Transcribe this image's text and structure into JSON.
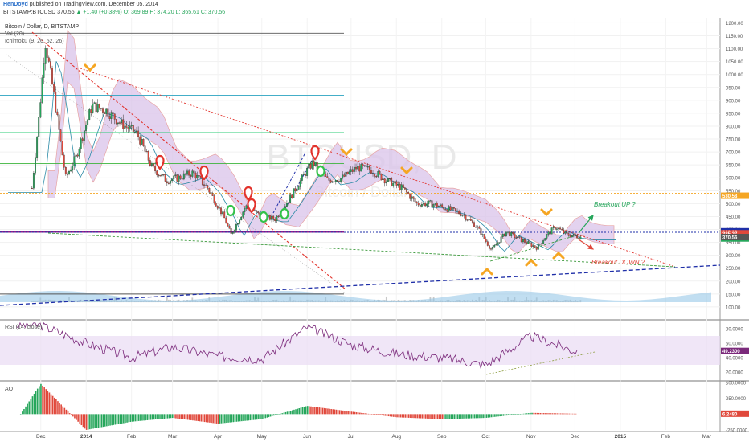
{
  "header": {
    "author": "HenDoyd",
    "published_text": "published on TradingView.com, December 05, 2014",
    "symbol": "BITSTAMP:BTCUSD",
    "last": "370.56",
    "change": "▲ +1.40 (+0.38%)",
    "open": "O: 369.89",
    "high": "H: 374.20",
    "low": "L: 365.61",
    "close": "C: 370.56"
  },
  "panes": {
    "main_title": "Bitcoin / Dollar, D, BITSTAMP",
    "vol_label": "Vol (20)",
    "ichimoku_label": "Ichimoku (9, 26, 52, 26)",
    "watermark": "BTCUSD, D",
    "watermark_sub": "Bitcoin / Dollar",
    "rsi_label": "RSI (14, close)",
    "ao_label": "AO"
  },
  "annotations": {
    "breakout_up": "Breakout UP ?",
    "breakout_down": "Breakout DOWN ?"
  },
  "colors": {
    "up": "#26a65b",
    "down": "#e0483b",
    "trend_red": "#e2322b",
    "trend_blue": "#1f2fa8",
    "purple_line": "#8b1e8b",
    "orange_line": "#f5a623",
    "rsi_line": "#7b2a7b",
    "cloud_fill": "#d9c3ea",
    "volume": "#8ec3e6"
  },
  "chart_data": [
    {
      "type": "line",
      "title": "Bitcoin / Dollar, D, BITSTAMP",
      "x": [
        "2013-11-25",
        "2013-11-30",
        "2013-12-04",
        "2013-12-10",
        "2013-12-18",
        "2013-12-25",
        "2014-01-05",
        "2014-01-15",
        "2014-01-25",
        "2014-02-05",
        "2014-02-15",
        "2014-02-25",
        "2014-03-05",
        "2014-03-15",
        "2014-03-25",
        "2014-04-05",
        "2014-04-10",
        "2014-04-20",
        "2014-05-01",
        "2014-05-10",
        "2014-05-20",
        "2014-06-01",
        "2014-06-05",
        "2014-06-15",
        "2014-06-25",
        "2014-07-05",
        "2014-07-15",
        "2014-07-25",
        "2014-08-05",
        "2014-08-15",
        "2014-08-25",
        "2014-09-05",
        "2014-09-15",
        "2014-09-25",
        "2014-10-05",
        "2014-10-15",
        "2014-10-25",
        "2014-11-05",
        "2014-11-12",
        "2014-11-18",
        "2014-11-25",
        "2014-12-05"
      ],
      "y": [
        560,
        850,
        1130,
        920,
        600,
        680,
        880,
        860,
        810,
        770,
        640,
        590,
        600,
        620,
        560,
        450,
        380,
        490,
        450,
        440,
        520,
        630,
        660,
        590,
        600,
        640,
        630,
        590,
        560,
        500,
        500,
        480,
        460,
        410,
        320,
        390,
        360,
        330,
        380,
        410,
        380,
        370.56
      ],
      "ylim": [
        50,
        1220
      ],
      "y_ticks": [
        100,
        150,
        200,
        250,
        300,
        350,
        400,
        450,
        500,
        550,
        600,
        650,
        700,
        750,
        800,
        850,
        900,
        950,
        1000,
        1050,
        1100,
        1150,
        1200
      ],
      "x_tick_labels": [
        "Dec",
        "2014",
        "Feb",
        "Mar",
        "Apr",
        "May",
        "Jun",
        "Jul",
        "Aug",
        "Sep",
        "Oct",
        "Nov",
        "Dec",
        "2015",
        "Feb",
        "Mar"
      ],
      "price_labels": [
        {
          "value": 530.58,
          "text": "530.58",
          "color": "#f5a623"
        },
        {
          "value": 392.88,
          "text": "392.88",
          "color": "#1f2fa8"
        },
        {
          "value": 385.27,
          "text": "385.27",
          "color": "#e0483b"
        },
        {
          "value": 365.14,
          "text": "365.14",
          "color": "#26a65b"
        },
        {
          "value": 370.56,
          "text": "370.56",
          "color": "#555555"
        }
      ],
      "horizontal_levels": [
        {
          "value": 1160,
          "color": "#555555"
        },
        {
          "value": 920,
          "color": "#2aa3c0"
        },
        {
          "value": 775,
          "color": "#2ccc77"
        },
        {
          "value": 655,
          "color": "#3cb43c"
        },
        {
          "value": 540,
          "color": "#f5a623"
        },
        {
          "value": 390,
          "color": "#8b1e8b"
        },
        {
          "value": 150,
          "color": "#555555"
        }
      ],
      "xlabel": "",
      "ylabel": ""
    },
    {
      "type": "line",
      "title": "RSI (14, close)",
      "x": [
        "2013-12",
        "2014-01",
        "2014-02",
        "2014-03",
        "2014-04",
        "2014-05",
        "2014-06",
        "2014-07",
        "2014-08",
        "2014-09",
        "2014-10",
        "2014-11",
        "2014-12"
      ],
      "y": [
        85,
        60,
        40,
        55,
        42,
        38,
        82,
        58,
        45,
        40,
        30,
        70,
        49.23
      ],
      "ylim": [
        10,
        90
      ],
      "y_ticks": [
        20,
        40,
        60,
        80
      ],
      "last_value": "49.2300",
      "xlabel": "",
      "ylabel": ""
    },
    {
      "type": "bar",
      "title": "AO",
      "x": [
        "2013-12",
        "2014-01",
        "2014-02",
        "2014-03",
        "2014-04",
        "2014-05",
        "2014-06",
        "2014-07",
        "2014-08",
        "2014-09",
        "2014-10",
        "2014-11",
        "2014-12"
      ],
      "values": [
        480,
        -250,
        -120,
        -60,
        -150,
        -80,
        130,
        40,
        -50,
        -80,
        -60,
        20,
        6.24
      ],
      "ylim": [
        -250,
        500
      ],
      "y_ticks": [
        -250,
        250,
        500
      ],
      "y_tick_labels": [
        "-250.0000",
        "250.0000",
        "500.0000"
      ],
      "last_value": "6.2480",
      "xlabel": "",
      "ylabel": ""
    }
  ]
}
